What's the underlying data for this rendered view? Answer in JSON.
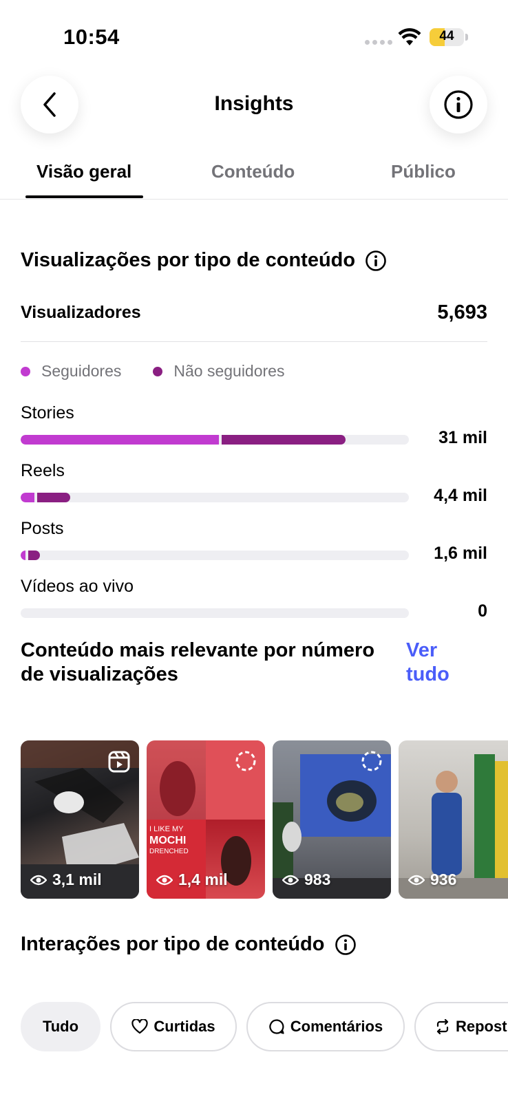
{
  "status_bar": {
    "time": "10:54",
    "battery": "44",
    "battery_level": 0.44
  },
  "header": {
    "title": "Insights"
  },
  "tabs": [
    {
      "label": "Visão geral",
      "active": true
    },
    {
      "label": "Conteúdo",
      "active": false
    },
    {
      "label": "Público",
      "active": false
    }
  ],
  "views_section": {
    "title": "Visualizações por tipo de conteúdo",
    "viewers_label": "Visualizadores",
    "viewers_value": "5,693",
    "legend": [
      {
        "label": "Seguidores",
        "color": "#c13bd0"
      },
      {
        "label": "Não seguidores",
        "color": "#8a1f82"
      }
    ],
    "rows": [
      {
        "label": "Stories",
        "value": "31 mil",
        "followers_share": 0.51,
        "non_followers_share": 0.32
      },
      {
        "label": "Reels",
        "value": "4,4 mil",
        "followers_share": 0.035,
        "non_followers_share": 0.085
      },
      {
        "label": "Posts",
        "value": "1,6 mil",
        "followers_share": 0.012,
        "non_followers_share": 0.03
      },
      {
        "label": "Vídeos ao vivo",
        "value": "0",
        "followers_share": 0,
        "non_followers_share": 0
      }
    ]
  },
  "top_content": {
    "title": "Conteúdo mais relevante por número de visualizações",
    "see_all": "Ver tudo",
    "items": [
      {
        "views": "3,1 mil",
        "type": "reel-icon"
      },
      {
        "views": "1,4 mil",
        "type": "story-icon"
      },
      {
        "views": "983",
        "type": "story-icon"
      },
      {
        "views": "936",
        "type": "story-icon"
      }
    ]
  },
  "interactions": {
    "title": "Interações por tipo de conteúdo",
    "filters": [
      {
        "label": "Tudo",
        "icon": "",
        "active": true
      },
      {
        "label": "Curtidas",
        "icon": "heart-icon",
        "active": false
      },
      {
        "label": "Comentários",
        "icon": "comment-icon",
        "active": false
      },
      {
        "label": "Repost",
        "icon": "repost-icon",
        "active": false
      }
    ]
  }
}
